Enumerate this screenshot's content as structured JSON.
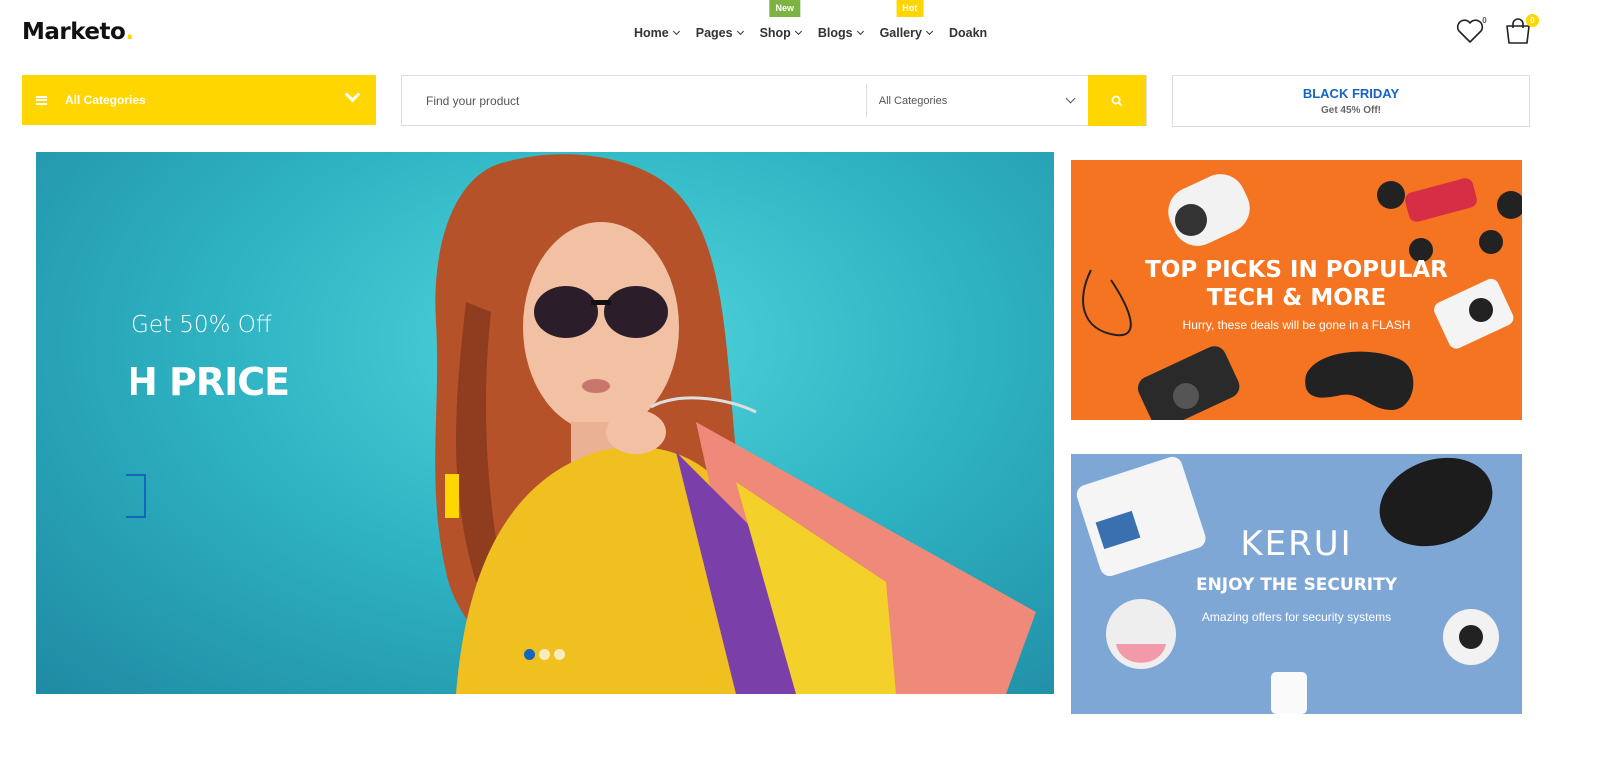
{
  "header": {
    "logo": "Marketo",
    "logo_dot": ".",
    "nav": [
      {
        "label": "Home",
        "has_dropdown": true
      },
      {
        "label": "Pages",
        "has_dropdown": true
      },
      {
        "label": "Shop",
        "has_dropdown": true,
        "tag": "New"
      },
      {
        "label": "Blogs",
        "has_dropdown": true
      },
      {
        "label": "Gallery",
        "has_dropdown": true,
        "tag": "Hot"
      },
      {
        "label": "Doakn",
        "has_dropdown": false
      }
    ],
    "wishlist_count": "0",
    "cart_count": "0"
  },
  "category_button": {
    "label": "All Categories",
    "icon": "menu-icon"
  },
  "search": {
    "placeholder": "Find your product",
    "category_select": "All Categories",
    "button_icon": "search-icon"
  },
  "promo": {
    "title": "BLACK FRIDAY",
    "subtitle": "Get 45% Off!"
  },
  "hero": {
    "subtitle": "Get 50% Off",
    "title": "H PRICE",
    "slides": 3,
    "active_slide": 1
  },
  "banners": [
    {
      "title_line1": "TOP PICKS IN POPULAR",
      "title_line2": "TECH & MORE",
      "subtitle": "Hurry, these deals will be gone in a FLASH"
    },
    {
      "brand": "KERUI",
      "title": "ENJOY THE SECURITY",
      "subtitle": "Amazing offers for security systems"
    }
  ],
  "colors": {
    "accent": "#ffd600",
    "primary": "#1565c0",
    "orange": "#f47421",
    "teal": "#2fb5c4",
    "steel_blue": "#7fa7d6"
  }
}
